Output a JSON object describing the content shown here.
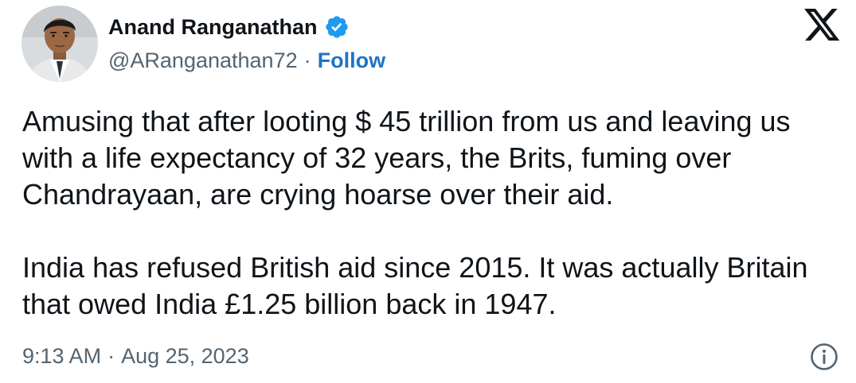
{
  "author": {
    "display_name": "Anand Ranganathan",
    "handle": "@ARanganathan72",
    "verified": true,
    "avatar_icon": "profile-photo"
  },
  "follow_label": "Follow",
  "separator": "·",
  "tweet": {
    "paragraphs": [
      "Amusing that after looting $ 45 trillion from us and leaving us with a life expectancy of 32 years, the Brits, fuming over Chandrayaan, are crying hoarse over their aid.",
      "India has refused British aid since 2015. It was actually Britain that owed India £1.25 billion back in 1947."
    ]
  },
  "meta": {
    "time": "9:13 AM",
    "date": "Aug 25, 2023"
  },
  "icons": {
    "verified": "verified-badge-icon",
    "platform": "x-logo-icon",
    "info": "info-icon"
  },
  "colors": {
    "text": "#0f1419",
    "secondary": "#536471",
    "link": "#1d74c7",
    "verified": "#1d9bf0"
  }
}
